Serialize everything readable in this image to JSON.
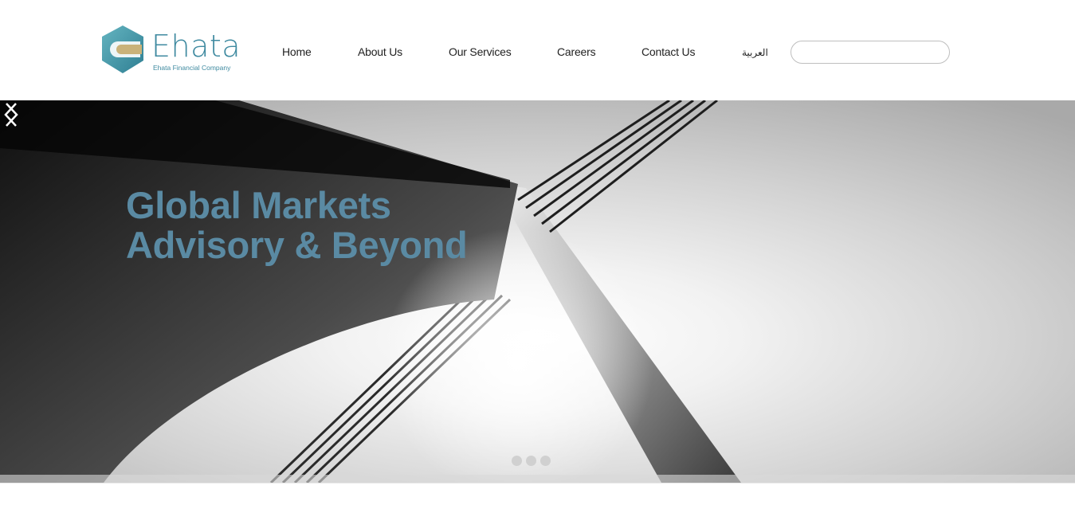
{
  "brand": {
    "name": "Ehata",
    "tagline": "Ehata Financial Company",
    "accent_color": "#3f8aa0",
    "gold_color": "#c9b27a"
  },
  "nav": {
    "items": [
      {
        "label": "Home"
      },
      {
        "label": "About Us"
      },
      {
        "label": "Our Services"
      },
      {
        "label": "Careers"
      },
      {
        "label": "Contact Us"
      },
      {
        "label": "العربية"
      }
    ]
  },
  "search": {
    "value": "",
    "placeholder": ""
  },
  "hero": {
    "title_line1": "Global Markets",
    "title_line2": "Advisory & Beyond",
    "title_color": "#5a8aa3",
    "slides_total": 3,
    "prev_icon": "chevron-left-icon",
    "next_icon": "chevron-right-icon"
  }
}
